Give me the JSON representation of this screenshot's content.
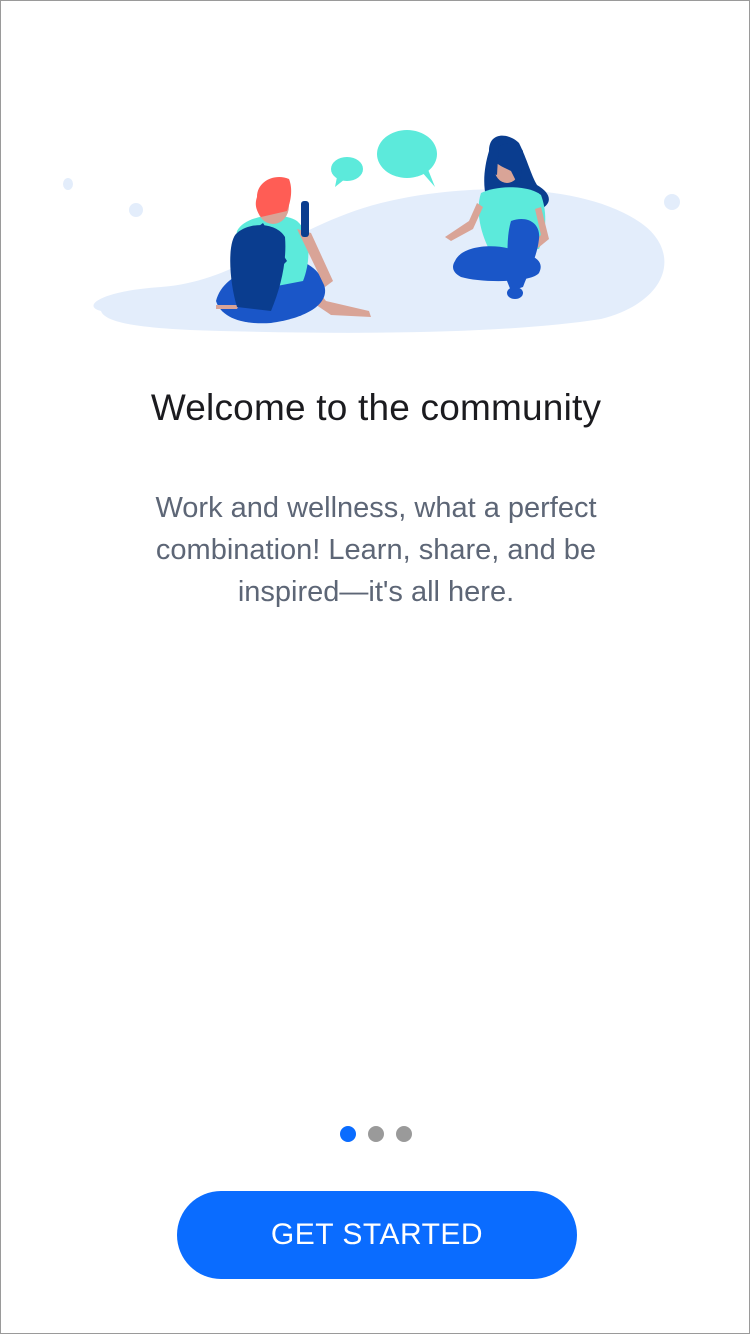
{
  "onboarding": {
    "title": "Welcome to the community",
    "subtitle": "Work and wellness, what a perfect combination! Learn, share, and be inspired—it's all here.",
    "cta_label": "GET STARTED",
    "pager": {
      "count": 3,
      "active_index": 0
    }
  },
  "illustration": {
    "description_icon": "community-illustration",
    "colors": {
      "ground": "#e3edfb",
      "accent_teal": "#5ceadb",
      "hair_red": "#ff5d55",
      "navy": "#0a3d8f",
      "blue": "#1a56c8",
      "skin": "#d9a497"
    }
  },
  "theme": {
    "primary": "#0a6cff",
    "dot_inactive": "#9a9a9a",
    "title_color": "#1b1b1f",
    "subtitle_color": "#5d6676"
  }
}
